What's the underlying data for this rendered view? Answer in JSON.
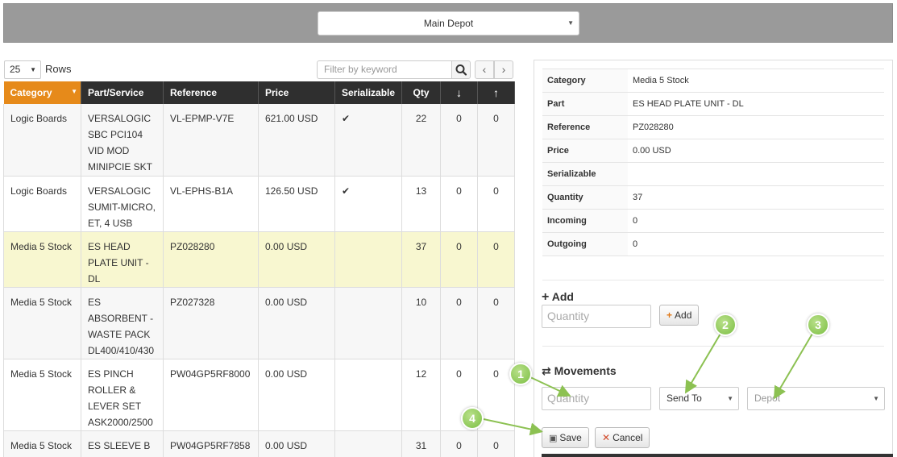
{
  "header": {
    "depot_selected": "Main Depot"
  },
  "controls": {
    "rows_value": "25",
    "rows_label": "Rows",
    "filter_placeholder": "Filter by keyword",
    "prev_glyph": "‹",
    "next_glyph": "›"
  },
  "table": {
    "columns": {
      "category": "Category",
      "part": "Part/Service",
      "reference": "Reference",
      "price": "Price",
      "serializable": "Serializable",
      "qty": "Qty",
      "incoming_icon": "↓",
      "outgoing_icon": "↑"
    },
    "rows": [
      {
        "category": "Logic Boards",
        "part": "VERSALOGIC SBC PCI104 VID MOD MINIPCIE SKT",
        "reference": "VL-EPMP-V7E",
        "price": "621.00 USD",
        "serializable": "✔",
        "qty": "22",
        "incoming": "0",
        "outgoing": "0"
      },
      {
        "category": "Logic Boards",
        "part": "VERSALOGIC SUMIT-MICRO, ET, 4 USB",
        "reference": "VL-EPHS-B1A",
        "price": "126.50 USD",
        "serializable": "✔",
        "qty": "13",
        "incoming": "0",
        "outgoing": "0"
      },
      {
        "category": "Media 5 Stock",
        "part": "ES HEAD PLATE UNIT - DL",
        "reference": "PZ028280",
        "price": "0.00 USD",
        "serializable": "",
        "qty": "37",
        "incoming": "0",
        "outgoing": "0"
      },
      {
        "category": "Media 5 Stock",
        "part": "ES ABSORBENT - WASTE PACK DL400/410/430",
        "reference": "PZ027328",
        "price": "0.00 USD",
        "serializable": "",
        "qty": "10",
        "incoming": "0",
        "outgoing": "0"
      },
      {
        "category": "Media 5 Stock",
        "part": "ES PINCH ROLLER & LEVER SET ASK2000/2500",
        "reference": "PW04GP5RF8000",
        "price": "0.00 USD",
        "serializable": "",
        "qty": "12",
        "incoming": "0",
        "outgoing": "0"
      },
      {
        "category": "Media 5 Stock",
        "part": "ES SLEEVE B RIBBON TAKE",
        "reference": "PW04GP5RF7858",
        "price": "0.00 USD",
        "serializable": "",
        "qty": "31",
        "incoming": "0",
        "outgoing": "0"
      }
    ]
  },
  "detail": {
    "fields": [
      {
        "label": "Category",
        "value": "Media 5 Stock"
      },
      {
        "label": "Part",
        "value": "ES HEAD PLATE UNIT - DL"
      },
      {
        "label": "Reference",
        "value": "PZ028280"
      },
      {
        "label": "Price",
        "value": "0.00 USD"
      },
      {
        "label": "Serializable",
        "value": ""
      },
      {
        "label": "Quantity",
        "value": "37"
      },
      {
        "label": "Incoming",
        "value": "0"
      },
      {
        "label": "Outgoing",
        "value": "0"
      }
    ],
    "add": {
      "title": "Add",
      "quantity_placeholder": "Quantity",
      "button_label": "Add"
    },
    "movements": {
      "title": "Movements",
      "quantity_placeholder": "Quantity",
      "send_to": "Send To",
      "depot": "Depot",
      "save_label": "Save",
      "cancel_label": "Cancel"
    }
  },
  "callouts": [
    "1",
    "2",
    "3",
    "4"
  ],
  "colors": {
    "sorted_header": "#e68a1a",
    "header_bg": "#2f2f2f",
    "selected_row": "#f8f7d0",
    "callout": "#7cbf44"
  }
}
